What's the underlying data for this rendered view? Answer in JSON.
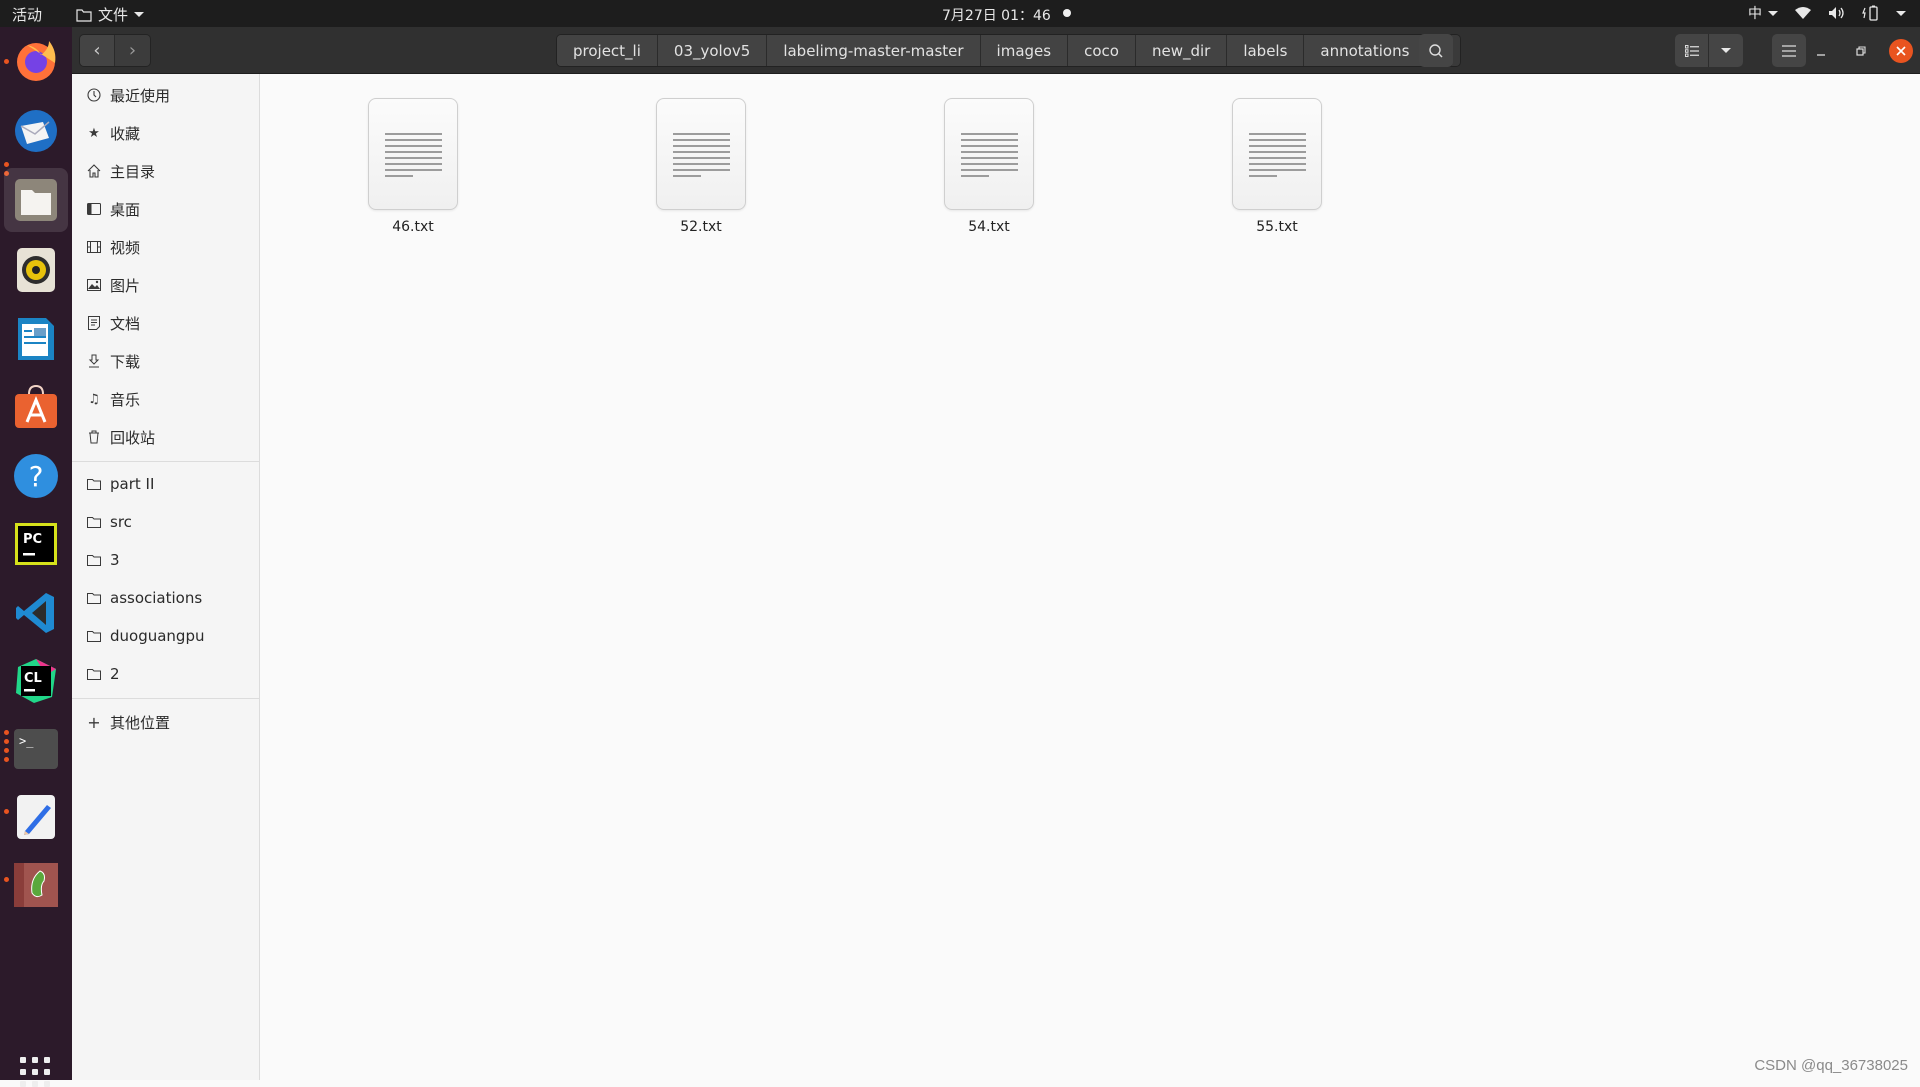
{
  "topbar": {
    "activities": "活动",
    "app_menu": "文件",
    "clock": "7月27日 01：46",
    "input_method": "中"
  },
  "dock": {
    "items": [
      {
        "name": "firefox",
        "running": true
      },
      {
        "name": "thunderbird",
        "running": false
      },
      {
        "name": "files",
        "running": true,
        "active": true
      },
      {
        "name": "rhythmbox",
        "running": false
      },
      {
        "name": "libreoffice-writer",
        "running": false
      },
      {
        "name": "ubuntu-software",
        "running": false
      },
      {
        "name": "help",
        "running": false
      },
      {
        "name": "pycharm",
        "running": false,
        "label": "PC"
      },
      {
        "name": "vscode",
        "running": false
      },
      {
        "name": "clion",
        "running": false,
        "label": "CL"
      },
      {
        "name": "terminal",
        "running": true,
        "label": ">_"
      },
      {
        "name": "text-editor",
        "running": true
      },
      {
        "name": "image-viewer",
        "running": true
      }
    ]
  },
  "header": {
    "path": [
      "project_li",
      "03_yolov5",
      "labelimg-master-master",
      "images",
      "coco",
      "new_dir",
      "labels",
      "annotations"
    ]
  },
  "sidebar": {
    "places": [
      {
        "label": "最近使用",
        "icon": "clock-icon"
      },
      {
        "label": "收藏",
        "icon": "star-icon"
      },
      {
        "label": "主目录",
        "icon": "home-icon"
      },
      {
        "label": "桌面",
        "icon": "desktop-icon"
      },
      {
        "label": "视频",
        "icon": "video-icon"
      },
      {
        "label": "图片",
        "icon": "picture-icon"
      },
      {
        "label": "文档",
        "icon": "document-icon"
      },
      {
        "label": "下载",
        "icon": "download-icon"
      },
      {
        "label": "音乐",
        "icon": "music-icon"
      },
      {
        "label": "回收站",
        "icon": "trash-icon"
      }
    ],
    "bookmarks": [
      {
        "label": "part II"
      },
      {
        "label": "src"
      },
      {
        "label": "3"
      },
      {
        "label": "associations"
      },
      {
        "label": "duoguangpu"
      },
      {
        "label": "2"
      }
    ],
    "other_locations": "其他位置"
  },
  "files": [
    {
      "name": "46.txt"
    },
    {
      "name": "52.txt"
    },
    {
      "name": "54.txt"
    },
    {
      "name": "55.txt"
    }
  ],
  "watermark": "CSDN @qq_36738025",
  "colors": {
    "accent": "#e95420",
    "topbar": "#1d1d1d",
    "dock": "#2c1a2a",
    "headerbar": "#303030"
  }
}
